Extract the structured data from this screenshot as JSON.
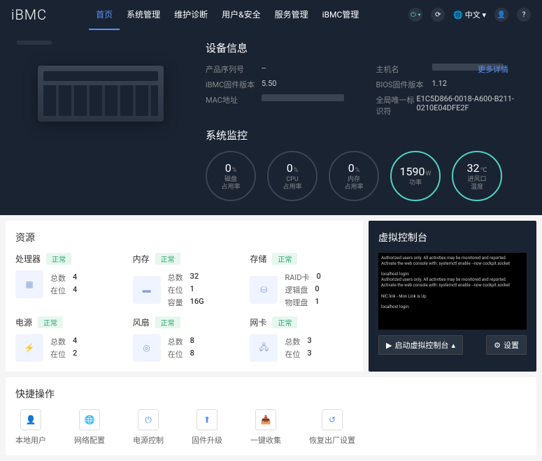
{
  "brand": "iBMC",
  "nav": [
    "首页",
    "系统管理",
    "维护诊断",
    "用户&安全",
    "服务管理",
    "iBMC管理"
  ],
  "lang": "中文",
  "device_info": {
    "title": "设备信息",
    "more": "更多详情",
    "rows": [
      {
        "l": "产品序列号",
        "v": "--"
      },
      {
        "l": "主机名",
        "v": "████████"
      },
      {
        "l": "iBMC固件版本",
        "v": "5.50"
      },
      {
        "l": "BIOS固件版本",
        "v": "1.12"
      },
      {
        "l": "MAC地址",
        "v": "██████████"
      },
      {
        "l": "全局唯一标识符",
        "v": "E1C5D866-0018-A600-B211-0210E04DFE2F"
      }
    ]
  },
  "monitor": {
    "title": "系统监控",
    "gauges": [
      {
        "val": "0",
        "unit": "%",
        "lbl": "磁盘\n占用率"
      },
      {
        "val": "0",
        "unit": "%",
        "lbl": "CPU\n占用率"
      },
      {
        "val": "0",
        "unit": "%",
        "lbl": "内存\n占用率"
      },
      {
        "val": "1590",
        "unit": "W",
        "lbl": "功率"
      },
      {
        "val": "32",
        "unit": "℃",
        "lbl": "进风口\n温度"
      }
    ]
  },
  "resources": {
    "title": "资源",
    "normal": "正常",
    "items": [
      {
        "name": "处理器",
        "s1": "总数",
        "v1": "4",
        "s2": "在位",
        "v2": "4"
      },
      {
        "name": "内存",
        "s1": "总数",
        "v1": "32",
        "s2": "在位",
        "v2": "1",
        "s3": "容量",
        "v3": "16G"
      },
      {
        "name": "存储",
        "s1": "RAID卡",
        "v1": "0",
        "s2": "逻辑盘",
        "v2": "0",
        "s3": "物理盘",
        "v3": "1"
      },
      {
        "name": "电源",
        "s1": "总数",
        "v1": "4",
        "s2": "在位",
        "v2": "2"
      },
      {
        "name": "风扇",
        "s1": "总数",
        "v1": "8",
        "s2": "在位",
        "v2": "8"
      },
      {
        "name": "网卡",
        "s1": "总数",
        "v1": "3",
        "s2": "在位",
        "v2": "3"
      }
    ]
  },
  "console": {
    "title": "虚拟控制台",
    "text": "Authorized users only. All activities may be monitored and reported.\nActivate the web console with: systemctl enable --now cockpit.socket\n\nlocalhost login:\nAuthorized users only. All activities may be monitored and reported.\nActivate the web console with: systemctl enable --now cockpit.socket\n\nNIC link - Mon Link is Up\n\nlocalhost login:",
    "launch": "启动虚拟控制台",
    "settings": "设置"
  },
  "quick": {
    "title": "快捷操作",
    "items": [
      "本地用户",
      "网络配置",
      "电源控制",
      "固件升级",
      "一键收集",
      "恢复出厂设置"
    ]
  }
}
